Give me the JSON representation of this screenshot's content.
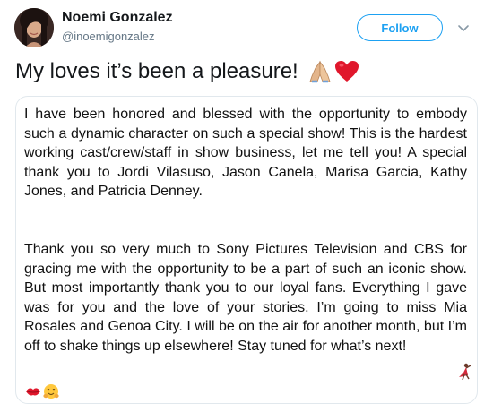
{
  "author": {
    "name": "Noemi Gonzalez",
    "handle": "@inoemigonzalez"
  },
  "follow_button": {
    "label": "Follow"
  },
  "tweet": {
    "text": "My loves it’s been a pleasure!",
    "emojis": [
      "folded-hands-emoji",
      "red-heart-emoji"
    ]
  },
  "statement": {
    "paragraph_1": "I have been honored and blessed with the opportunity to embody such a dynamic character on such a special show! This is the hardest working cast/crew/staff in show business, let me tell you! A special thank you to Jordi Vilasuso, Jason Canela, Marisa Garcia, Kathy Jones, and Patricia Denney.",
    "paragraph_2": "Thank you so very much to Sony Pictures Television and CBS for gracing me with the opportunity to be a part of such an iconic show. But most importantly thank you to our loyal fans. Everything I gave was for you and the love of your stories. I’m going to miss Mia Rosales and Genoa City. I will be on the air for another month, but I’m off to shake things up elsewhere! Stay tuned for what’s next!",
    "trailing_emojis": [
      "dancer-emoji",
      "kiss-mark-emoji",
      "hugging-face-emoji"
    ]
  },
  "colors": {
    "accent": "#1da1f2",
    "handle_gray": "#657786",
    "card_border": "#e1e8ed",
    "text": "#14171a"
  }
}
